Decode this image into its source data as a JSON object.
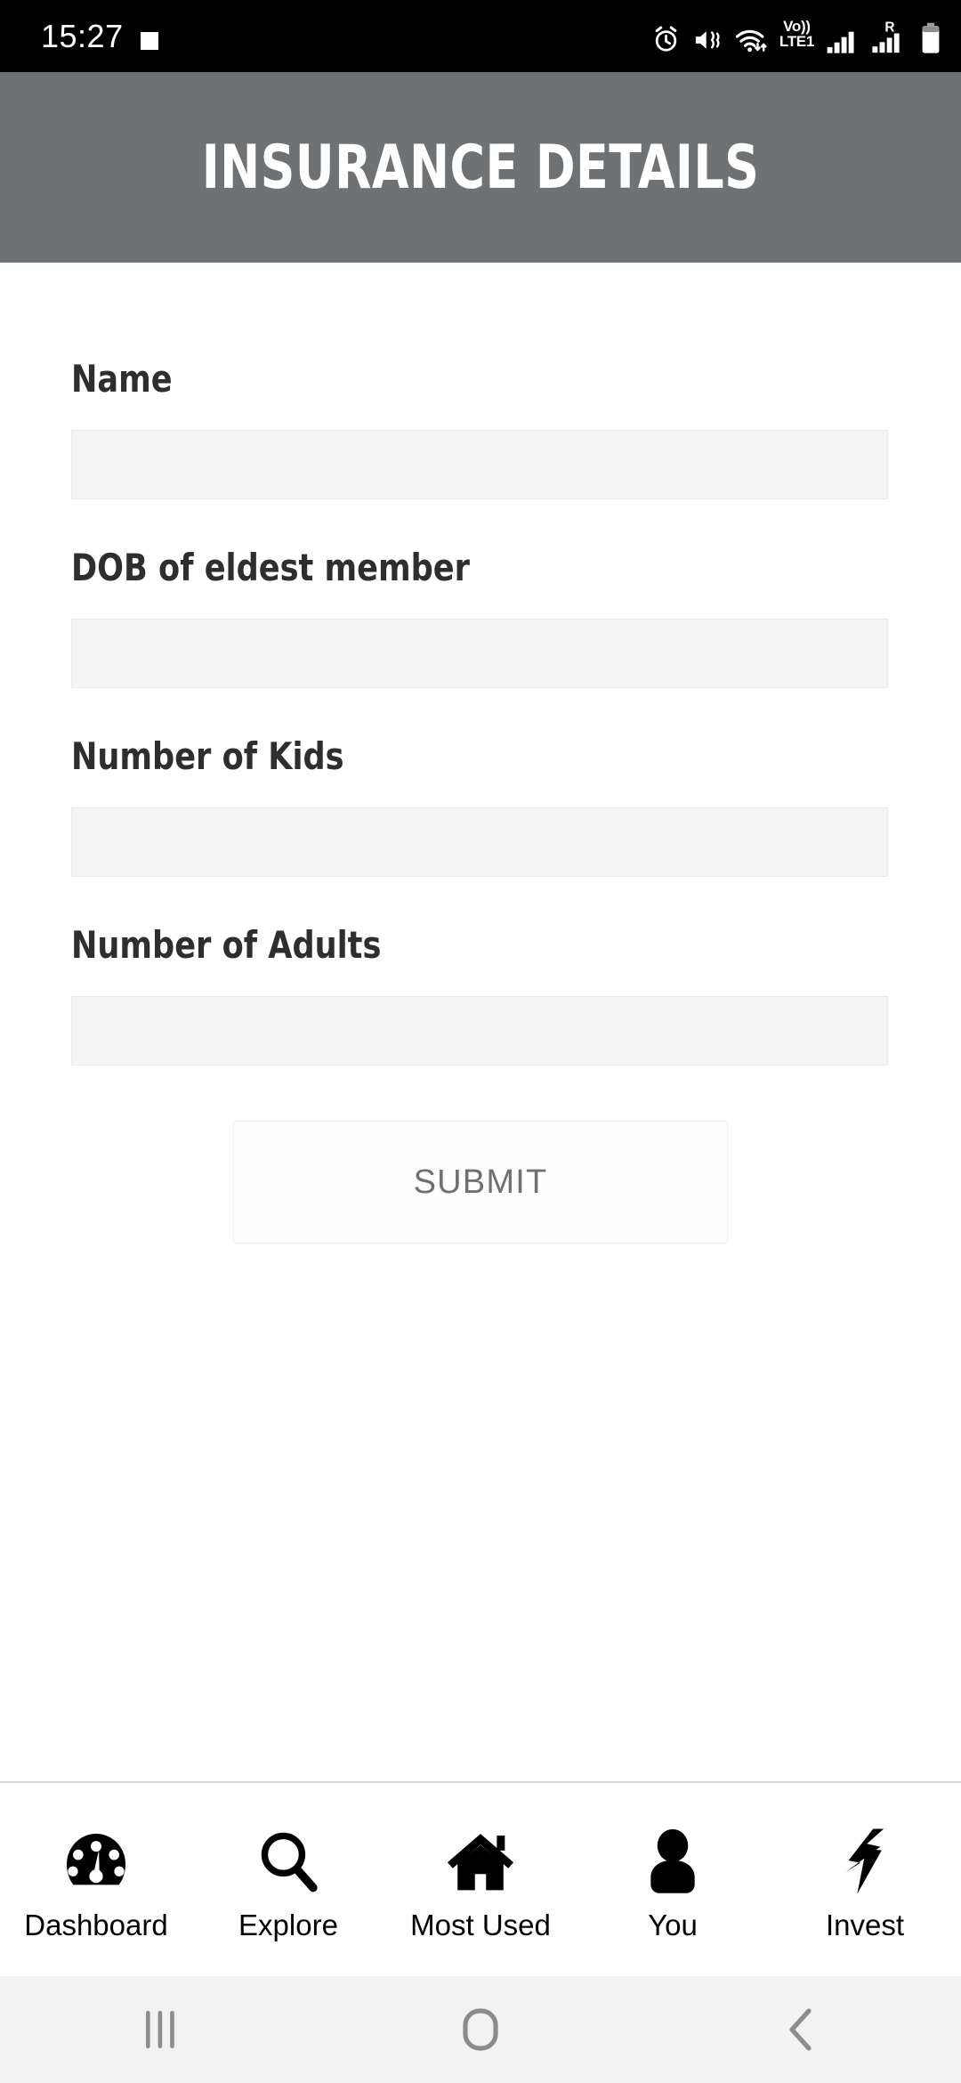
{
  "statusbar": {
    "time": "15:27",
    "left_icons": [
      "image-icon"
    ],
    "right_icons": [
      "alarm-icon",
      "mute-vibrate-icon",
      "wifi-icon",
      "volte-icon",
      "signal-icon",
      "roaming-signal-icon",
      "battery-icon"
    ],
    "volte_line1": "Vo))",
    "volte_line2": "LTE1",
    "roaming_label": "R"
  },
  "appbar": {
    "title": "INSURANCE DETAILS",
    "background_color": "#6e7274",
    "text_color": "#ffffff"
  },
  "form": {
    "fields": [
      {
        "label": "Name",
        "value": "",
        "placeholder": ""
      },
      {
        "label": "DOB of eldest member",
        "value": "",
        "placeholder": ""
      },
      {
        "label": "Number of Kids",
        "value": "",
        "placeholder": ""
      },
      {
        "label": "Number of Adults",
        "value": "",
        "placeholder": ""
      }
    ],
    "submit_label": "SUBMIT",
    "input_background": "#f4f4f4",
    "label_color": "#2e2e2e",
    "submit_text_color": "#707070"
  },
  "bottomnav": {
    "items": [
      {
        "label": "Dashboard",
        "icon": "dashboard-gauge-icon"
      },
      {
        "label": "Explore",
        "icon": "search-icon"
      },
      {
        "label": "Most Used",
        "icon": "home-icon"
      },
      {
        "label": "You",
        "icon": "person-icon"
      },
      {
        "label": "Invest",
        "icon": "lightning-bolt-icon"
      }
    ]
  },
  "androidnav": {
    "recents": "recents-icon",
    "home": "home-button-icon",
    "back": "back-icon",
    "background_color": "#f2f2f2",
    "icon_color": "#8c8c8c"
  }
}
